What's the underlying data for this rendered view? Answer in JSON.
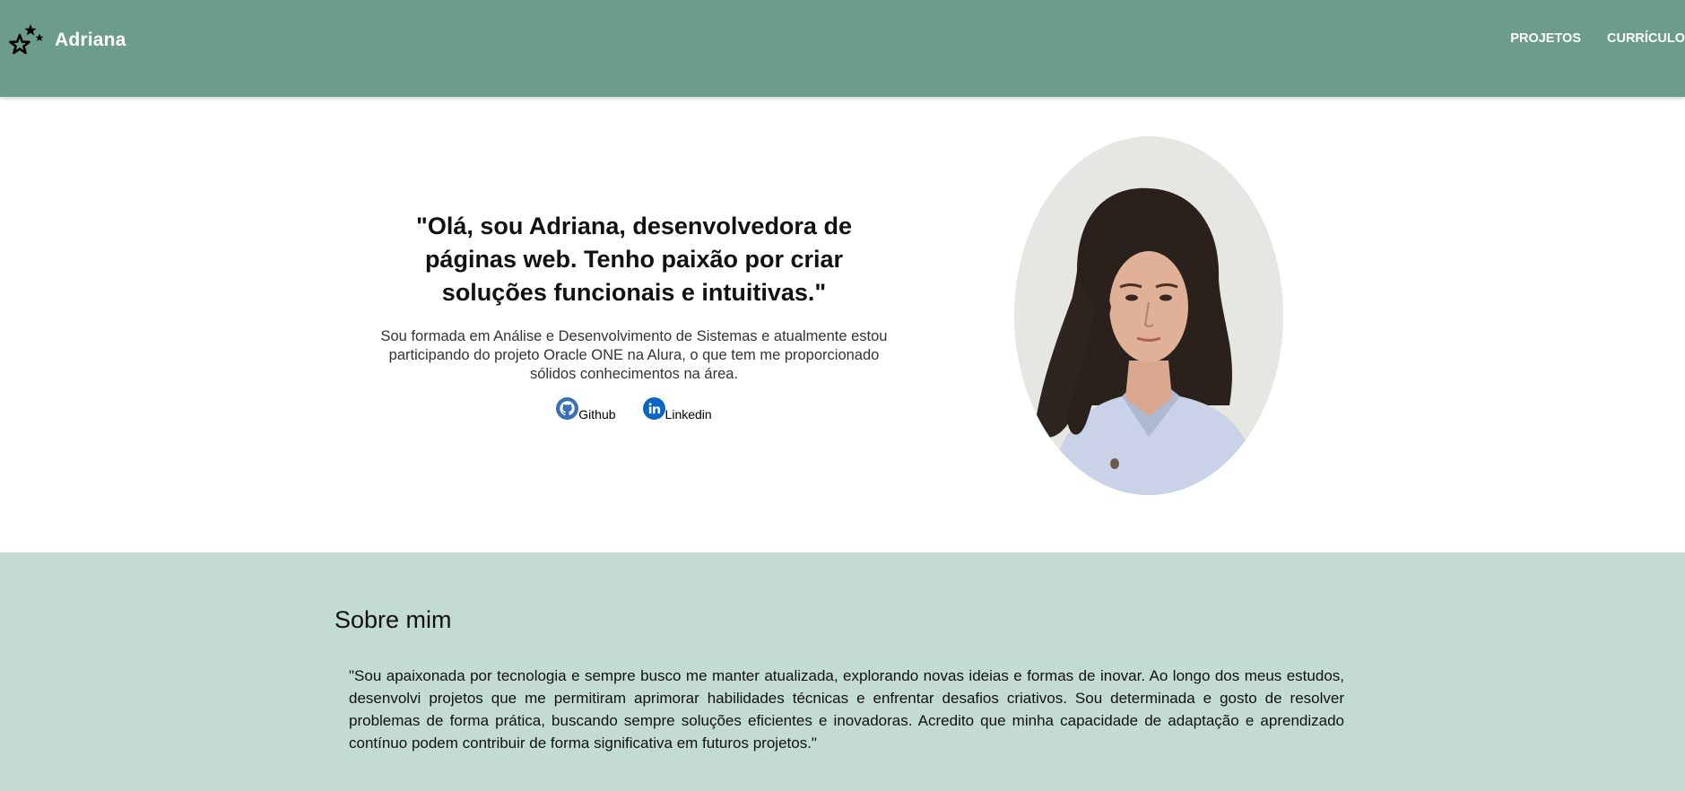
{
  "header": {
    "brand_name": "Adriana",
    "brand_icon": "stars-icon",
    "nav": [
      {
        "label": "Projetos"
      },
      {
        "label": "Currículo"
      }
    ],
    "background_color": "#6c9c8a"
  },
  "hero": {
    "title": "\"Olá, sou Adriana, desenvolvedora de páginas web. Tenho paixão por criar soluções funcionais e intuitivas.\"",
    "description": "Sou formada em Análise e Desenvolvimento de Sistemas e atualmente estou participando do projeto Oracle ONE na Alura, o que tem me proporcionado sólidos conhecimentos na área.",
    "social": [
      {
        "label": "Github",
        "icon": "github-icon"
      },
      {
        "label": "Linkedin",
        "icon": "linkedin-icon"
      }
    ],
    "portrait_alt": "photo"
  },
  "about": {
    "title": "Sobre mim",
    "text": "\"Sou apaixonada por tecnologia e sempre busco me manter atualizada, explorando novas ideias e formas de inovar. Ao longo dos meus estudos, desenvolvi projetos que me permitiram aprimorar habilidades técnicas e enfrentar desafios criativos. Sou determinada e gosto de resolver problemas de forma prática, buscando sempre soluções eficientes e inovadoras. Acredito que minha capacidade de adaptação e aprendizado contínuo podem contribuir de forma significativa em futuros projetos.\"",
    "background_color": "#c4dbd4"
  },
  "colors": {
    "github": "#3b6fb6",
    "linkedin": "#0a66c2"
  }
}
